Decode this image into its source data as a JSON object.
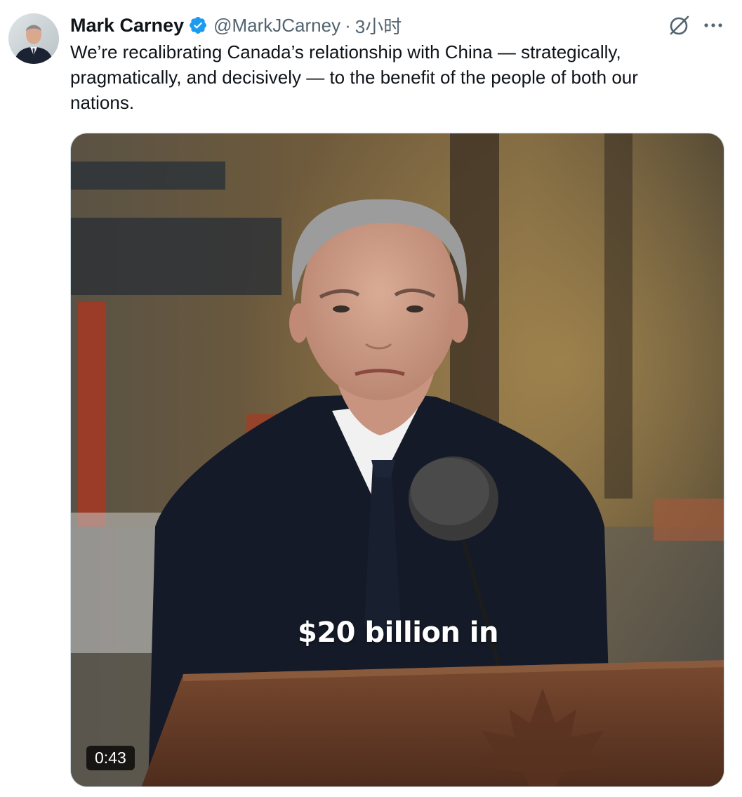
{
  "author": {
    "display_name": "Mark Carney",
    "handle": "@MarkJCarney",
    "separator": "·",
    "timestamp": "3小时",
    "verified_icon": "verified-badge-icon",
    "verified_color": "#1d9bf0"
  },
  "tweet": {
    "text": "We’re recalibrating Canada’s relationship with China — strategically, pragmatically, and decisively — to the benefit of the people of both our nations."
  },
  "actions": {
    "grok_icon": "grok-icon",
    "more_icon": "more-options-icon"
  },
  "media": {
    "type": "video",
    "caption": "$20 billion in",
    "duration": "0:43"
  },
  "colors": {
    "text_primary": "#0f1419",
    "text_secondary": "#536471",
    "border": "#cfd9de"
  }
}
